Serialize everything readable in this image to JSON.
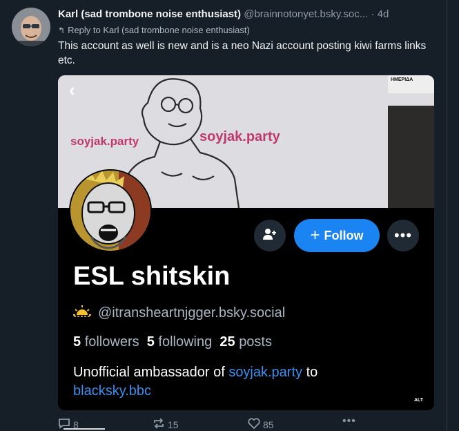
{
  "post": {
    "author_name": "Karl (sad trombone noise enthusiast)",
    "author_handle": "@brainnotonyet.bsky.soc...",
    "separator": "·",
    "timestamp": "4d",
    "reply_to": "Reply to Karl (sad trombone noise enthusiast)",
    "text": "This account as well is new and is a neo Nazi account posting kiwi farms links etc."
  },
  "embed": {
    "banner_text_1": "soyjak.party",
    "banner_text_2": "soyjak.party",
    "newspaper_logo": "ΗΜΕΡΙΔΑ",
    "follow_label": "Follow",
    "display_name": "ESL shitskin",
    "handle": "@itransheartnjgger.bsky.social",
    "followers_count": "5",
    "followers_label": "followers",
    "following_count": "5",
    "following_label": "following",
    "posts_count": "25",
    "posts_label": "posts",
    "bio_prefix": "Unofficial ambassador of",
    "bio_link_1": "soyjak.party",
    "bio_mid": "to",
    "bio_link_2": "blacksky.bbc",
    "alt_badge": "ALT"
  },
  "actions": {
    "reply_count": "8",
    "repost_count": "15",
    "like_count": "85"
  },
  "colors": {
    "background": "#161e27",
    "follow_button": "#1a84f3",
    "link": "#3b8ff0",
    "banner_text": "#c0386e"
  },
  "icons": [
    "back-chevron-icon",
    "add-person-icon",
    "plus-icon",
    "more-icon",
    "sun-icon",
    "reply-icon",
    "repost-icon",
    "like-icon"
  ]
}
